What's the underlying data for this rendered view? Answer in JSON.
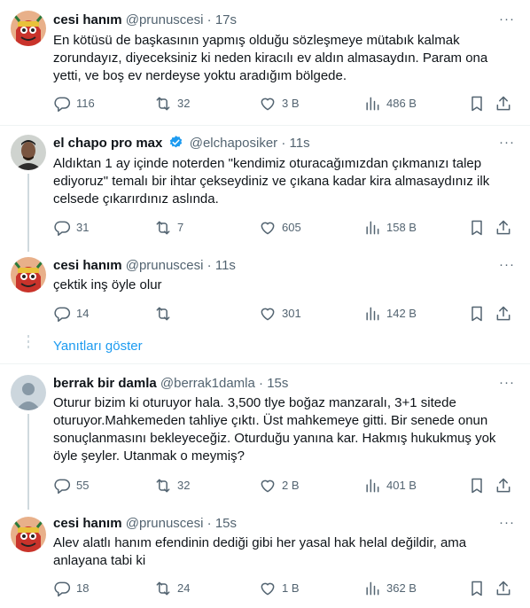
{
  "tweets": [
    {
      "name": "cesi hanım",
      "handle": "@prunuscesi",
      "sep": "·",
      "time": "17s",
      "text": "En kötüsü de başkasının yapmış olduğu sözleşmeye mütabık kalmak zorundayız, diyeceksiniz ki neden kiracılı ev aldın almasaydın. Param ona yetti, ve boş ev nerdeyse yoktu aradığım bölgede.",
      "replies": "116",
      "retweets": "32",
      "likes": "3 B",
      "views": "486 B"
    },
    {
      "name": "el chapo pro max",
      "handle": "@elchaposiker",
      "sep": "·",
      "time": "11s",
      "text": "Aldıktan 1 ay içinde noterden \"kendimiz oturacağımızdan çıkmanızı talep ediyoruz\" temalı bir ihtar çekseydiniz ve çıkana kadar kira almasaydınız ilk celsede çıkarırdınız aslında.",
      "replies": "31",
      "retweets": "7",
      "likes": "605",
      "views": "158 B"
    },
    {
      "name": "cesi hanım",
      "handle": "@prunuscesi",
      "sep": "·",
      "time": "11s",
      "text": "çektik inş öyle olur",
      "replies": "14",
      "retweets": "",
      "likes": "301",
      "views": "142 B"
    },
    {
      "name": "berrak bir damla",
      "handle": "@berrak1damla",
      "sep": "·",
      "time": "15s",
      "text": "Oturur bizim ki oturuyor hala. 3,500 tlye boğaz manzaralı, 3+1 sitede oturuyor.Mahkemeden tahliye çıktı. Üst mahkemeye gitti. Bir senede onun sonuçlanmasını bekleyeceğiz. Oturduğu yanına kar. Hakmış hukukmuş yok öyle şeyler. Utanmak o meymiş?",
      "replies": "55",
      "retweets": "32",
      "likes": "2 B",
      "views": "401 B"
    },
    {
      "name": "cesi hanım",
      "handle": "@prunuscesi",
      "sep": "·",
      "time": "15s",
      "text": "Alev alatlı hanım efendinin dediği gibi her yasal hak helal değildir, ama anlayana tabi ki",
      "replies": "18",
      "retweets": "24",
      "likes": "1 B",
      "views": "362 B"
    }
  ],
  "show_replies": "Yanıtları göster",
  "more_glyph": "···",
  "colors": {
    "accent": "#1d9bf0",
    "secondary_text": "#536471",
    "divider": "#eff3f4",
    "thread_line": "#cfd9de"
  },
  "icons": [
    "reply-icon",
    "retweet-icon",
    "like-icon",
    "views-icon",
    "bookmark-icon",
    "share-icon",
    "more-icon",
    "verified-badge-icon"
  ]
}
